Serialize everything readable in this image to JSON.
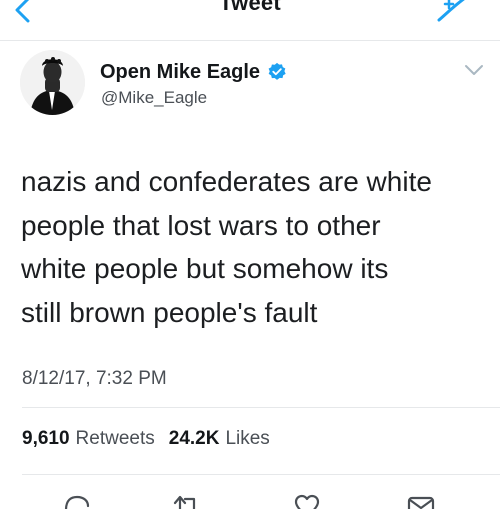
{
  "nav": {
    "title": "Tweet"
  },
  "author": {
    "name": "Open Mike Eagle",
    "handle": "@Mike_Eagle"
  },
  "tweet": {
    "lines": [
      "nazis and confederates are white",
      "people that lost wars to other",
      "white people but somehow its",
      "still brown people's fault"
    ],
    "timestamp": "8/12/17, 7:32 PM"
  },
  "stats": {
    "retweets_count": "9,610",
    "retweets_label": "Retweets",
    "likes_count": "24.2K",
    "likes_label": "Likes"
  },
  "icons": {
    "back": "chevron-left-icon",
    "compose": "compose-tweet-icon",
    "verified": "verified-badge-icon",
    "caret": "chevron-down-icon",
    "reply": "reply-icon",
    "retweet": "retweet-icon",
    "like": "heart-icon",
    "share": "share-icon"
  },
  "colors": {
    "accent": "#1da1f2",
    "text": "#14171a",
    "secondary": "#4a4f55"
  }
}
